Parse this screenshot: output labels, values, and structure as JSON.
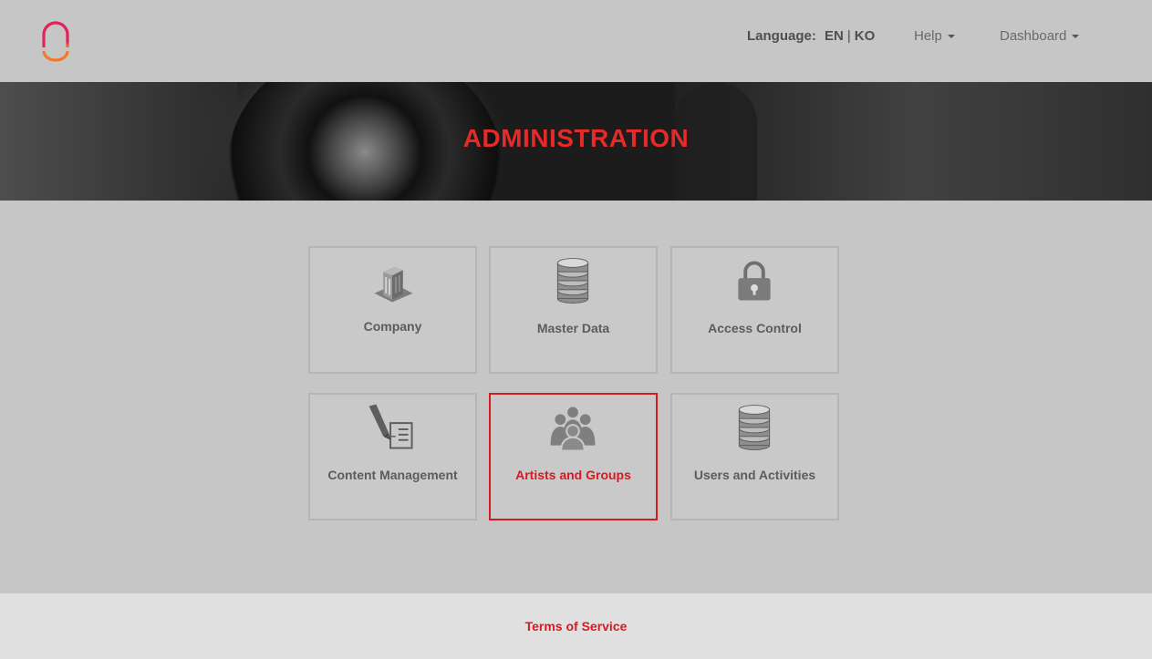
{
  "header": {
    "language_label": "Language:",
    "language_options": [
      "EN",
      "KO"
    ],
    "language_separator": "|",
    "help_label": "Help",
    "dashboard_label": "Dashboard"
  },
  "banner": {
    "title": "ADMINISTRATION"
  },
  "tiles": [
    {
      "label": "Company",
      "icon": "building-icon"
    },
    {
      "label": "Master Data",
      "icon": "database-icon"
    },
    {
      "label": "Access Control",
      "icon": "padlock-icon"
    },
    {
      "label": "Content Management",
      "icon": "document-pen-icon"
    },
    {
      "label": "Artists and Groups",
      "icon": "group-people-icon",
      "active": true
    },
    {
      "label": "Users and Activities",
      "icon": "database-icon"
    }
  ],
  "footer": {
    "terms_label": "Terms of Service"
  },
  "colors": {
    "accent": "#d71920",
    "title_red": "#e52a2a",
    "background": "#c6c6c6",
    "footer_bg": "#e0e0e0"
  }
}
